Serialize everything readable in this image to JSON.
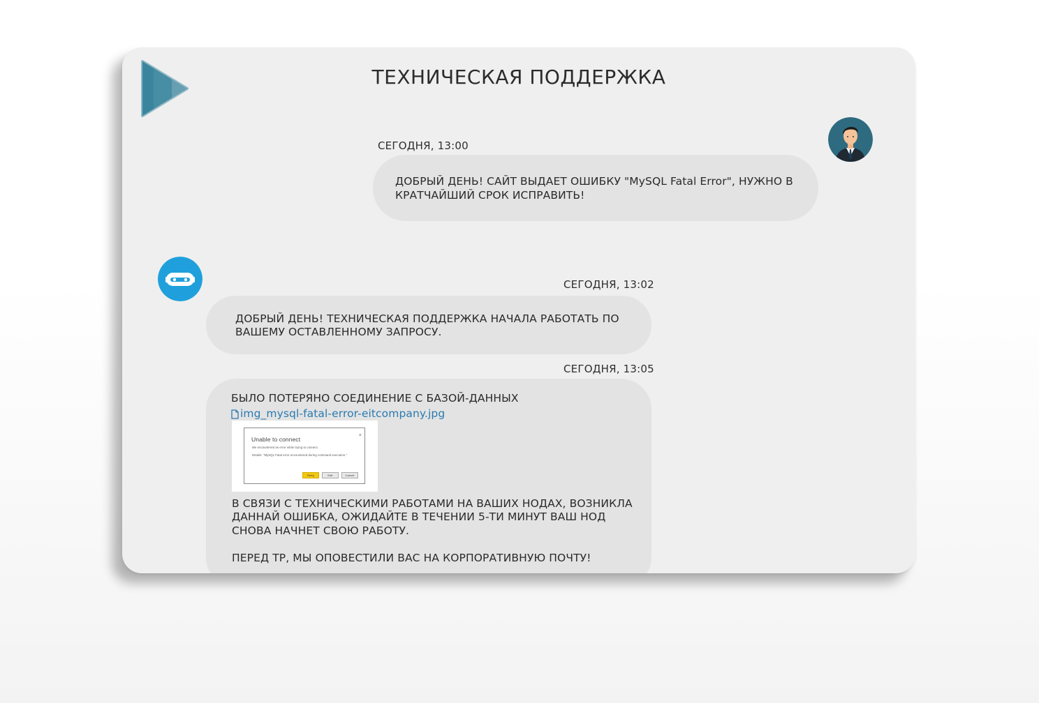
{
  "header": {
    "title": "ТЕХНИЧЕСКАЯ ПОДДЕРЖКА",
    "logo_icon": "play-logo-icon"
  },
  "messages": [
    {
      "sender": "user",
      "avatar_icon": "user-avatar-icon",
      "time": "СЕГОДНЯ, 13:00",
      "text": "ДОБРЫЙ ДЕНЬ! САЙТ ВЫДАЕТ ОШИБКУ \"MySQL Fatal Error\", НУЖНО В КРАТЧАЙШИЙ СРОК ИСПРАВИТЬ!"
    },
    {
      "sender": "bot",
      "avatar_icon": "bot-avatar-icon",
      "time": "СЕГОДНЯ, 13:02",
      "text": "ДОБРЫЙ ДЕНЬ! ТЕХНИЧЕСКАЯ ПОДДЕРЖКА НАЧАЛА РАБОТАТЬ ПО ВАШЕМУ ОСТАВЛЕННОМУ ЗАПРОСУ."
    },
    {
      "sender": "bot",
      "time": "СЕГОДНЯ, 13:05",
      "line1": "БЫЛО ПОТЕРЯНО СОЕДИНЕНИЕ С БАЗОЙ-ДАННЫХ",
      "attachment": {
        "filename": "img_mysql-fatal-error-eitcompany.jpg",
        "icon": "file-icon",
        "preview": {
          "title": "Unable to connect",
          "close": "×",
          "line1": "We encountered an error while trying to connect.",
          "line2": "Details: \"MySQL Fatal error encountered during command execution.\"",
          "buttons": [
            "Retry",
            "Edit",
            "Cancel"
          ]
        }
      },
      "paragraph1": "В СВЯЗИ С ТЕХНИЧЕСКИМИ РАБОТАМИ НА ВАШИХ НОДАХ, ВОЗНИКЛА ДАННАЙ ОШИБКА, ОЖИДАЙТЕ В ТЕЧЕНИИ 5-ТИ МИНУТ ВАШ НОД СНОВА НАЧНЕТ СВОЮ РАБОТУ.",
      "paragraph2": "ПЕРЕД ТР, МЫ ОПОВЕСТИЛИ ВАС НА КОРПОРАТИВНУЮ ПОЧТУ!"
    }
  ],
  "colors": {
    "window_bg": "#efefef",
    "bubble_bg": "#e3e3e3",
    "bot_avatar": "#1fa0dc",
    "user_avatar_bg": "#2e6b80",
    "link": "#2a7ab0",
    "logo": "#2d7e98"
  }
}
